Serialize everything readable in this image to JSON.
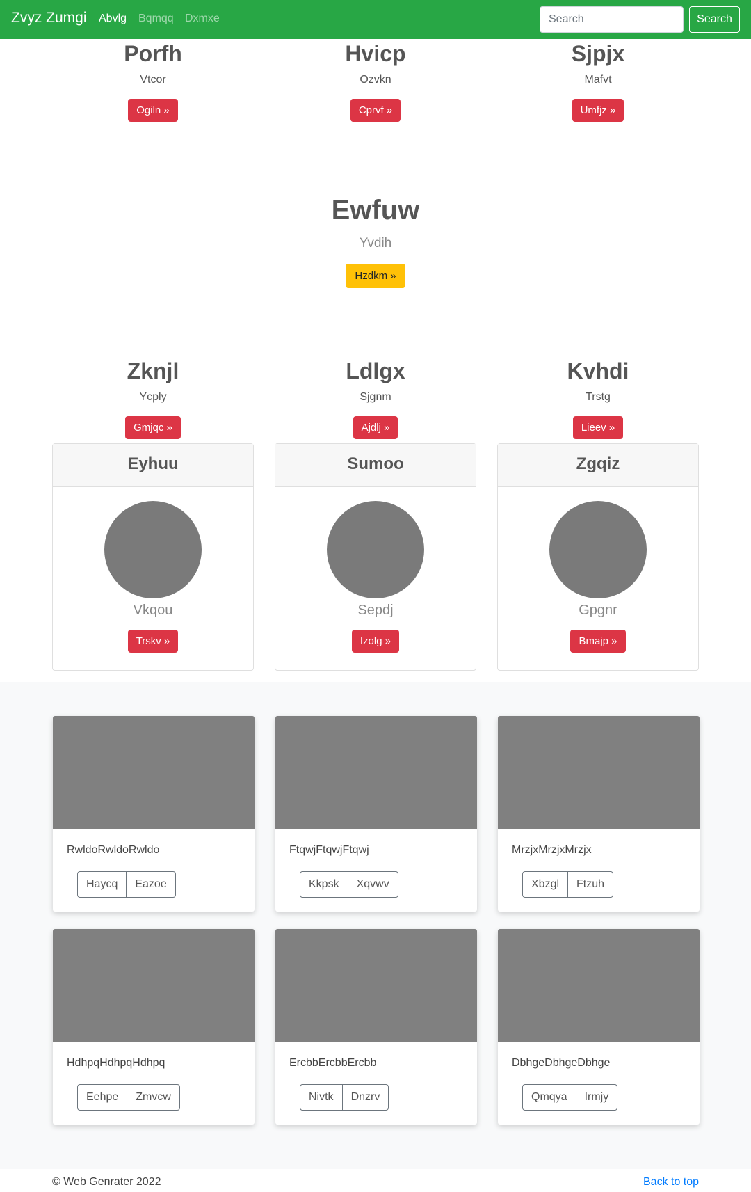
{
  "navbar": {
    "brand": "Zvyz Zumgi",
    "links": [
      "Abvlg",
      "Bqmqq",
      "Dxmxe"
    ],
    "search_placeholder": "Search",
    "search_button": "Search"
  },
  "row1": [
    {
      "title": "Porfh",
      "subtitle": "Vtcor",
      "button": "Ogiln »"
    },
    {
      "title": "Hvicp",
      "subtitle": "Ozvkn",
      "button": "Cprvf »"
    },
    {
      "title": "Sjpjx",
      "subtitle": "Mafvt",
      "button": "Umfjz »"
    }
  ],
  "hero": {
    "title": "Ewfuw",
    "subtitle": "Yvdih",
    "button": "Hzdkm »"
  },
  "row2": [
    {
      "title": "Zknjl",
      "subtitle": "Ycply",
      "button": "Gmjqc »"
    },
    {
      "title": "Ldlgx",
      "subtitle": "Sjgnm",
      "button": "Ajdlj »"
    },
    {
      "title": "Kvhdi",
      "subtitle": "Trstg",
      "button": "Lieev »"
    }
  ],
  "profiles": [
    {
      "header": "Eyhuu",
      "name": "Vkqou",
      "button": "Trskv »"
    },
    {
      "header": "Sumoo",
      "name": "Sepdj",
      "button": "Izolg »"
    },
    {
      "header": "Zgqiz",
      "name": "Gpgnr",
      "button": "Bmajp »"
    }
  ],
  "album": [
    {
      "text": "RwldoRwldoRwldo",
      "buttons": [
        "Haycq",
        "Eazoe"
      ]
    },
    {
      "text": "FtqwjFtqwjFtqwj",
      "buttons": [
        "Kkpsk",
        "Xqvwv"
      ]
    },
    {
      "text": "MrzjxMrzjxMrzjx",
      "buttons": [
        "Xbzgl",
        "Ftzuh"
      ]
    },
    {
      "text": "HdhpqHdhpqHdhpq",
      "buttons": [
        "Eehpe",
        "Zmvcw"
      ]
    },
    {
      "text": "ErcbbErcbbErcbb",
      "buttons": [
        "Nivtk",
        "Dnzrv"
      ]
    },
    {
      "text": "DbhgeDbhgeDbhge",
      "buttons": [
        "Qmqya",
        "Irmjy"
      ]
    }
  ],
  "footer": {
    "copyright": "© Web Genrater 2022",
    "back_to_top": "Back to top"
  },
  "colors": {
    "navbar": "#28a745",
    "danger": "#dc3545",
    "warning": "#ffc107",
    "link": "#007bff"
  }
}
